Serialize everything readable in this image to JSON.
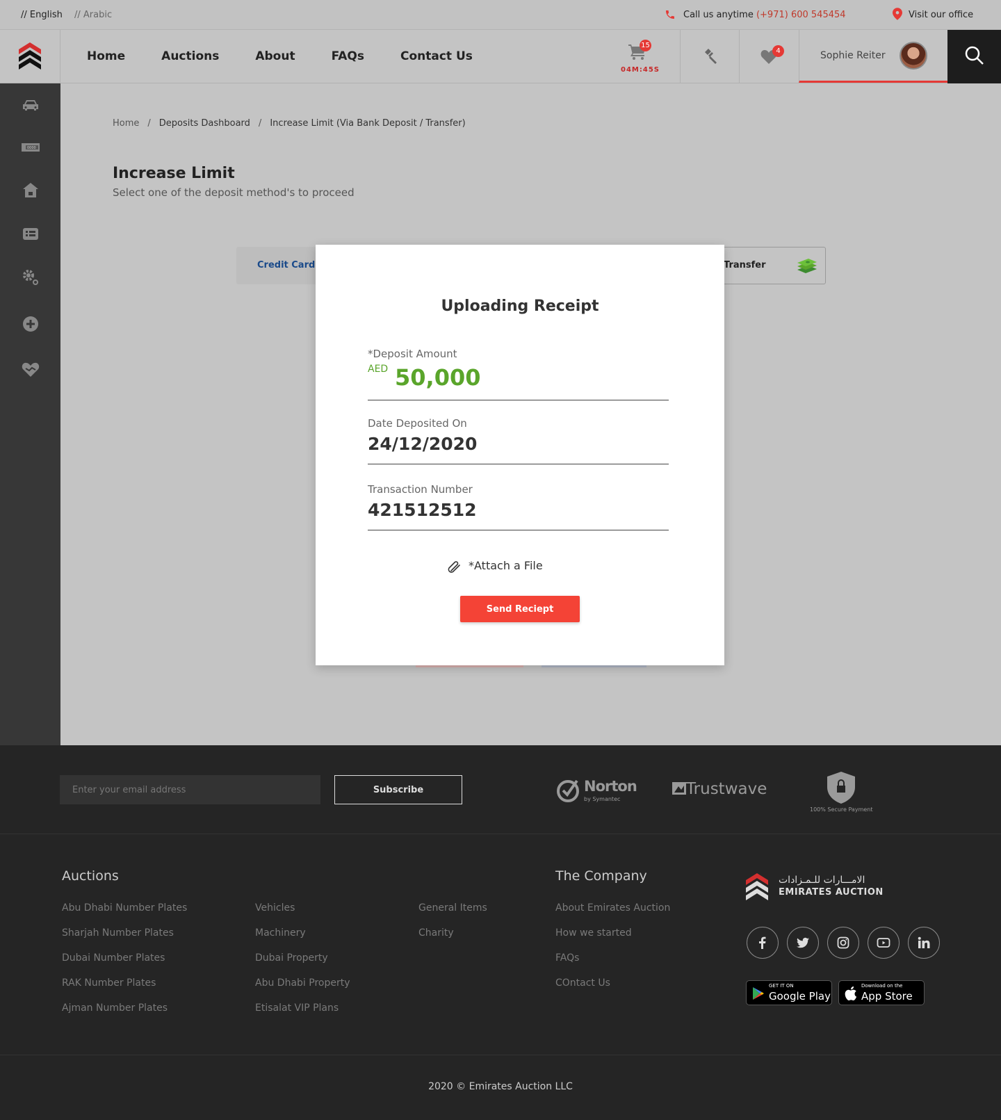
{
  "topbar": {
    "lang_en": "// English",
    "lang_ar": "// Arabic",
    "call_label": "Call us anytime",
    "call_number": "(+971) 600 545454",
    "visit_label": "Visit our office"
  },
  "nav": {
    "items": [
      "Home",
      "Auctions",
      "About",
      "FAQs",
      "Contact Us"
    ]
  },
  "header": {
    "cart_count": "15",
    "timer": "04M:45S",
    "fav_count": "4",
    "user_name": "Sophie Reiter"
  },
  "sidebar": {
    "icons": [
      "car-icon",
      "number-plate-icon",
      "property-icon",
      "list-icon",
      "settings-icon",
      "add-icon",
      "charity-icon"
    ]
  },
  "breadcrumb": {
    "home": "Home",
    "deposits": "Deposits Dashboard",
    "current": "Increase Limit (Via Bank Deposit / Transfer)"
  },
  "page": {
    "title": "Increase Limit",
    "subtitle": "Select one of the deposit method's to proceed"
  },
  "methods": {
    "credit_card": "Credit Card",
    "bank_transfer": "Transfer"
  },
  "modal": {
    "title": "Uploading Receipt",
    "deposit_label": "*Deposit Amount",
    "currency": "AED",
    "deposit_value": "50,000",
    "date_label": "Date Deposited On",
    "date_value": "24/12/2020",
    "txn_label": "Transaction Number",
    "txn_value": "421512512",
    "attach_label": "*Attach a File",
    "send_label": "Send Reciept"
  },
  "footer": {
    "email_placeholder": "Enter your email address",
    "subscribe_label": "Subscribe",
    "norton": "Norton",
    "norton_sub": "by Symantec",
    "trustwave": "Trustwave",
    "secure": "100% Secure Payment",
    "auctions_title": "Auctions",
    "auctions_col1": [
      "Abu Dhabi Number Plates",
      "Sharjah Number Plates",
      "Dubai Number Plates",
      "RAK Number Plates",
      "Ajman Number Plates"
    ],
    "auctions_col2": [
      "Vehicles",
      "Machinery",
      "Dubai Property",
      "Abu Dhabi Property",
      "Etisalat VIP Plans"
    ],
    "auctions_col3": [
      "General Items",
      "Charity"
    ],
    "company_title": "The Company",
    "company_links": [
      "About Emirates Auction",
      "How we started",
      "FAQs",
      "COntact Us"
    ],
    "brand_ar": "الامـــارات للـمـزادات",
    "brand_en": "EMIRATES AUCTION",
    "social": [
      "facebook-icon",
      "twitter-icon",
      "instagram-icon",
      "youtube-icon",
      "linkedin-icon"
    ],
    "google_small": "GET IT ON",
    "google_big": "Google Play",
    "apple_small": "Download on the",
    "apple_big": "App Store",
    "copyright": "2020 © Emirates Auction LLC"
  },
  "colors": {
    "accent_red": "#f44336",
    "amount_green": "#5aa52b",
    "dark": "#252525"
  }
}
